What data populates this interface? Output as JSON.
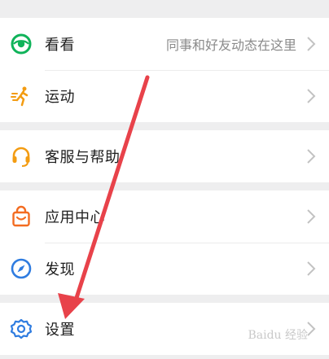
{
  "menu": {
    "kankan": {
      "label": "看看",
      "subtitle": "同事和好友动态在这里",
      "icon": "eye-icon",
      "color": "#10b35a"
    },
    "yundong": {
      "label": "运动",
      "icon": "running-person-icon",
      "color": "#f39c12"
    },
    "kefu": {
      "label": "客服与帮助",
      "icon": "headset-icon",
      "color": "#f39c12"
    },
    "yingyong": {
      "label": "应用中心",
      "icon": "shopping-bag-icon",
      "color": "#f36c21"
    },
    "faxian": {
      "label": "发现",
      "icon": "compass-icon",
      "color": "#2f7ce0"
    },
    "shezhi": {
      "label": "设置",
      "icon": "gear-icon",
      "color": "#2f7ce0"
    }
  },
  "annotation": {
    "arrow_color": "#e8424a"
  },
  "watermark": {
    "text": "Baidu 经验"
  }
}
